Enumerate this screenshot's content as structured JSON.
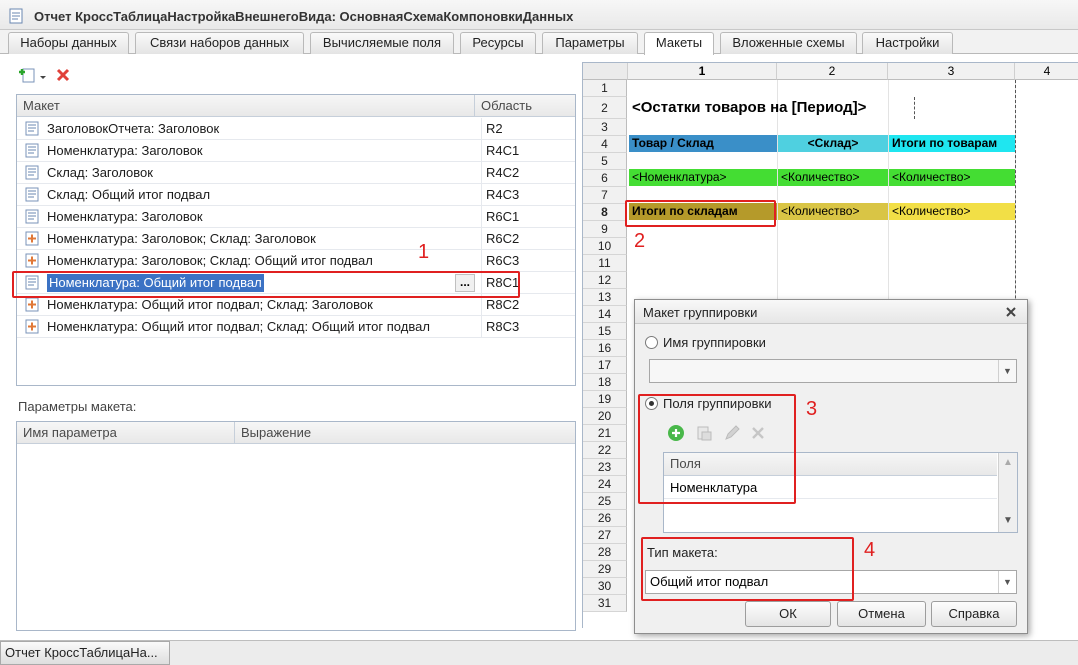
{
  "window": {
    "title": "Отчет КроссТаблицаНастройкаВнешнегоВида: ОсновнаяСхемаКомпоновкиДанных"
  },
  "tabs": [
    "Наборы данных",
    "Связи наборов данных",
    "Вычисляемые поля",
    "Ресурсы",
    "Параметры",
    "Макеты",
    "Вложенные схемы",
    "Настройки"
  ],
  "active_tab": "Макеты",
  "templates_table": {
    "headers": [
      "Макет",
      "Область"
    ],
    "rows": [
      {
        "name": "ЗаголовокОтчета: Заголовок",
        "area": "R2",
        "icon": "doc-icon"
      },
      {
        "name": "Номенклатура: Заголовок",
        "area": "R4C1",
        "icon": "doc-icon"
      },
      {
        "name": "Склад: Заголовок",
        "area": "R4C2",
        "icon": "doc-icon"
      },
      {
        "name": "Склад: Общий итог подвал",
        "area": "R4C3",
        "icon": "doc-icon"
      },
      {
        "name": "Номенклатура: Заголовок",
        "area": "R6C1",
        "icon": "doc-icon"
      },
      {
        "name": "Номенклатура: Заголовок; Склад: Заголовок",
        "area": "R6C2",
        "icon": "cross-doc-icon"
      },
      {
        "name": "Номенклатура: Заголовок; Склад: Общий итог подвал",
        "area": "R6C3",
        "icon": "cross-doc-icon"
      },
      {
        "name": "Номенклатура: Общий итог подвал",
        "area": "R8C1",
        "icon": "doc-icon"
      },
      {
        "name": "Номенклатура: Общий итог подвал; Склад: Заголовок",
        "area": "R8C2",
        "icon": "cross-doc-icon"
      },
      {
        "name": "Номенклатура: Общий итог подвал; Склад: Общий итог подвал",
        "area": "R8C3",
        "icon": "cross-doc-icon"
      }
    ],
    "selected_row": 7,
    "ellipsis": "..."
  },
  "params": {
    "label": "Параметры макета:",
    "headers": [
      "Имя параметра",
      "Выражение"
    ]
  },
  "sheet": {
    "col_headers": [
      "1",
      "2",
      "3",
      "4"
    ],
    "row_numbers": [
      "1",
      "2",
      "3",
      "4",
      "5",
      "6",
      "7",
      "8",
      "9",
      "10",
      "11",
      "12",
      "13",
      "14",
      "15",
      "16",
      "17",
      "18",
      "19",
      "20",
      "21",
      "22",
      "23",
      "24",
      "25",
      "26",
      "27",
      "28",
      "29",
      "30",
      "31"
    ],
    "title": "<Остатки товаров на [Период]>",
    "r4": [
      "Товар / Склад",
      "<Склад>",
      "Итоги по товарам"
    ],
    "r6": [
      "<Номенклатура>",
      "<Количество>",
      "<Количество>"
    ],
    "r8": [
      "Итоги по складам",
      "<Количество>",
      "<Количество>"
    ],
    "colors": {
      "r4c1": "#3a8fc8",
      "r4c2": "#4fd0e0",
      "r4c3": "#1fe6f0",
      "r6": "#44dd33",
      "r8c1": "#b59a2a",
      "r8c2": "#d9c545",
      "r8c3": "#f2df46"
    }
  },
  "dialog": {
    "title": "Макет группировки",
    "radio_name": "Имя группировки",
    "radio_fields": "Поля группировки",
    "fields_header": "Поля",
    "fields": [
      "Номенклатура"
    ],
    "type_label": "Тип макета:",
    "type_value": "Общий итог подвал",
    "ok": "ОК",
    "cancel": "Отмена",
    "help": "Справка"
  },
  "annotations": [
    "1",
    "2",
    "3",
    "4"
  ],
  "status_tab": "Отчет КроссТаблицаНа..."
}
